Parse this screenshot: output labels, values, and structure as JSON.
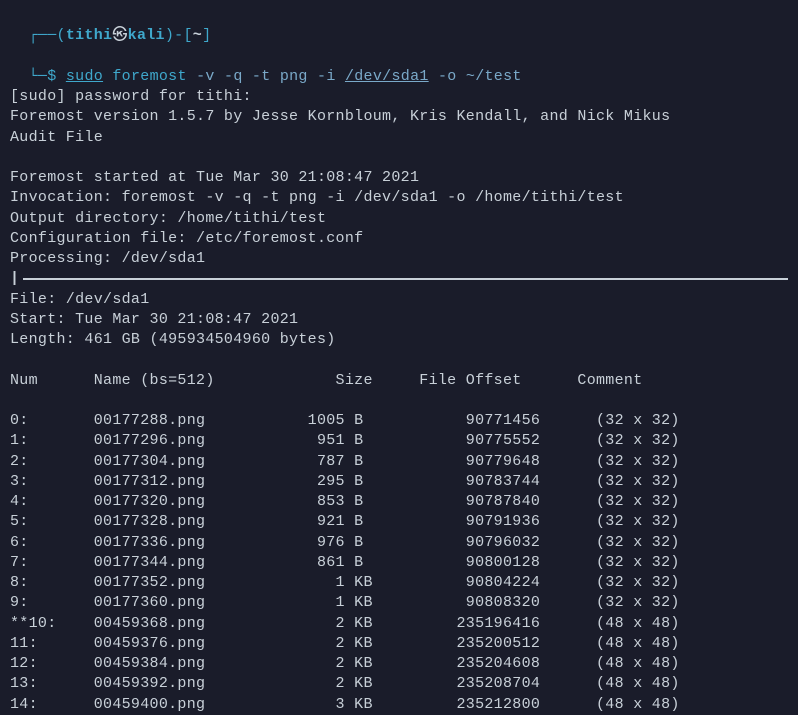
{
  "prompt": {
    "open": "┌──(",
    "user": "tithi",
    "skull": "㉿",
    "host": "kali",
    "close_uh": ")-[",
    "path": "~",
    "close_path": "]",
    "line2_open": "└─",
    "dollar": "$",
    "sudo": "sudo",
    "cmd": "foremost",
    "flags1": "-v -q -t png -i",
    "dev": "/dev/sda1",
    "flags2": "-o ~/test"
  },
  "lines": [
    "[sudo] password for tithi:",
    "Foremost version 1.5.7 by Jesse Kornbloum, Kris Kendall, and Nick Mikus",
    "Audit File",
    "",
    "Foremost started at Tue Mar 30 21:08:47 2021",
    "Invocation: foremost -v -q -t png -i /dev/sda1 -o /home/tithi/test",
    "Output directory: /home/tithi/test",
    "Configuration file: /etc/foremost.conf",
    "Processing: /dev/sda1"
  ],
  "after_hr": [
    "File: /dev/sda1",
    "Start: Tue Mar 30 21:08:47 2021",
    "Length: 461 GB (495934504960 bytes)",
    ""
  ],
  "header": {
    "num": "Num",
    "name": "Name (bs=512)",
    "size": "Size",
    "offset": "File Offset",
    "comment": "Comment"
  },
  "rows": [
    {
      "num": "0:",
      "name": "00177288.png",
      "size": "1005 B ",
      "offset": "90771456",
      "comment": "(32 x 32)"
    },
    {
      "num": "1:",
      "name": "00177296.png",
      "size": "951 B ",
      "offset": "90775552",
      "comment": "(32 x 32)"
    },
    {
      "num": "2:",
      "name": "00177304.png",
      "size": "787 B ",
      "offset": "90779648",
      "comment": "(32 x 32)"
    },
    {
      "num": "3:",
      "name": "00177312.png",
      "size": "295 B ",
      "offset": "90783744",
      "comment": "(32 x 32)"
    },
    {
      "num": "4:",
      "name": "00177320.png",
      "size": "853 B ",
      "offset": "90787840",
      "comment": "(32 x 32)"
    },
    {
      "num": "5:",
      "name": "00177328.png",
      "size": "921 B ",
      "offset": "90791936",
      "comment": "(32 x 32)"
    },
    {
      "num": "6:",
      "name": "00177336.png",
      "size": "976 B ",
      "offset": "90796032",
      "comment": "(32 x 32)"
    },
    {
      "num": "7:",
      "name": "00177344.png",
      "size": "861 B ",
      "offset": "90800128",
      "comment": "(32 x 32)"
    },
    {
      "num": "8:",
      "name": "00177352.png",
      "size": "1 KB",
      "offset": "90804224",
      "comment": "(32 x 32)"
    },
    {
      "num": "9:",
      "name": "00177360.png",
      "size": "1 KB",
      "offset": "90808320",
      "comment": "(32 x 32)"
    },
    {
      "num": "**10:",
      "name": "00459368.png",
      "size": "2 KB",
      "offset": "235196416",
      "comment": "(48 x 48)"
    },
    {
      "num": "11:",
      "name": "00459376.png",
      "size": "2 KB",
      "offset": "235200512",
      "comment": "(48 x 48)"
    },
    {
      "num": "12:",
      "name": "00459384.png",
      "size": "2 KB",
      "offset": "235204608",
      "comment": "(48 x 48)"
    },
    {
      "num": "13:",
      "name": "00459392.png",
      "size": "2 KB",
      "offset": "235208704",
      "comment": "(48 x 48)"
    },
    {
      "num": "14:",
      "name": "00459400.png",
      "size": "3 KB",
      "offset": "235212800",
      "comment": "(48 x 48)"
    }
  ]
}
